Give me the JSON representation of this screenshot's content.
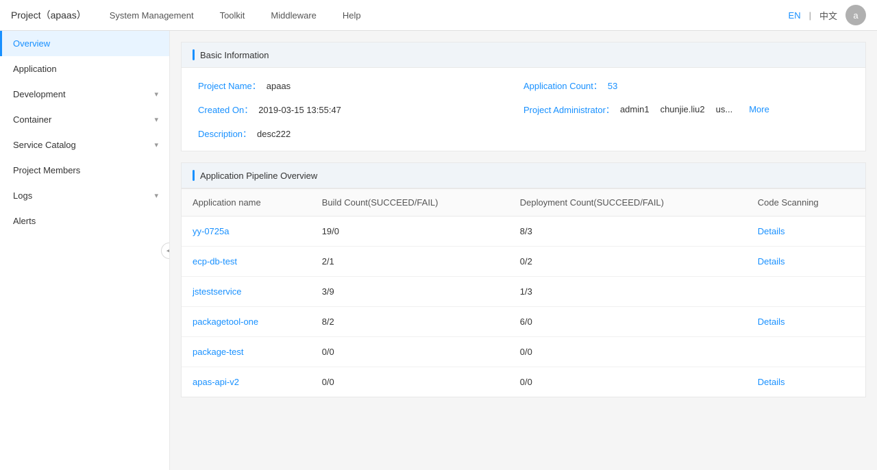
{
  "topNav": {
    "logo": "Project（apaas）",
    "items": [
      "System Management",
      "Toolkit",
      "Middleware",
      "Help"
    ],
    "langEN": "EN",
    "langSep": "|",
    "langZH": "中文",
    "avatarLabel": "a"
  },
  "sidebar": {
    "items": [
      {
        "id": "overview",
        "label": "Overview",
        "active": true,
        "hasChevron": false
      },
      {
        "id": "application",
        "label": "Application",
        "active": false,
        "hasChevron": false
      },
      {
        "id": "development",
        "label": "Development",
        "active": false,
        "hasChevron": true
      },
      {
        "id": "container",
        "label": "Container",
        "active": false,
        "hasChevron": true
      },
      {
        "id": "service-catalog",
        "label": "Service Catalog",
        "active": false,
        "hasChevron": true
      },
      {
        "id": "project-members",
        "label": "Project Members",
        "active": false,
        "hasChevron": false
      },
      {
        "id": "logs",
        "label": "Logs",
        "active": false,
        "hasChevron": true
      },
      {
        "id": "alerts",
        "label": "Alerts",
        "active": false,
        "hasChevron": false
      }
    ],
    "collapseIcon": "◀"
  },
  "basicInfo": {
    "sectionTitle": "Basic Information",
    "projectNameLabel": "Project Name：",
    "projectNameValue": "apaas",
    "applicationCountLabel": "Application Count：",
    "applicationCountValue": "53",
    "createdOnLabel": "Created On：",
    "createdOnValue": "2019-03-15 13:55:47",
    "projectAdminLabel": "Project Administrator：",
    "projectAdminValues": [
      "admin1",
      "chunjie.liu2",
      "us..."
    ],
    "moreLabel": "More",
    "descriptionLabel": "Description：",
    "descriptionValue": "desc222"
  },
  "pipelineOverview": {
    "sectionTitle": "Application Pipeline Overview",
    "columns": [
      "Application name",
      "Build Count(SUCCEED/FAIL)",
      "Deployment Count(SUCCEED/FAIL)",
      "Code Scanning"
    ],
    "rows": [
      {
        "name": "yy-0725a",
        "build": "19/0",
        "deployment": "8/3",
        "scanning": "Details",
        "hasDetails": true
      },
      {
        "name": "ecp-db-test",
        "build": "2/1",
        "deployment": "0/2",
        "scanning": "Details",
        "hasDetails": true
      },
      {
        "name": "jstestservice",
        "build": "3/9",
        "deployment": "1/3",
        "scanning": "",
        "hasDetails": false
      },
      {
        "name": "packagetool-one",
        "build": "8/2",
        "deployment": "6/0",
        "scanning": "Details",
        "hasDetails": true
      },
      {
        "name": "package-test",
        "build": "0/0",
        "deployment": "0/0",
        "scanning": "",
        "hasDetails": false
      },
      {
        "name": "apas-api-v2",
        "build": "0/0",
        "deployment": "0/0",
        "scanning": "Details",
        "hasDetails": true
      }
    ]
  }
}
